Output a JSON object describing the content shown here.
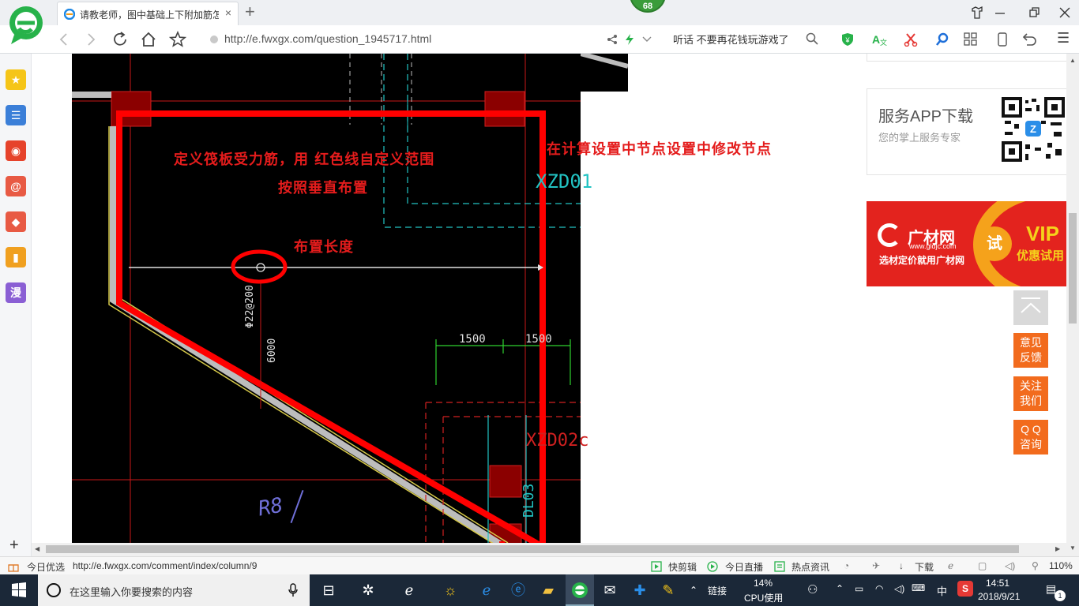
{
  "browser": {
    "tab_title": "请教老师，图中基础上下附加筋怎",
    "tab_close": "×",
    "new_tab": "+",
    "badge": "68",
    "url": "http://e.fwxgx.com/question_1945717.html",
    "hot_search": "听话 不要再花钱玩游戏了",
    "menu_glyph": "☰"
  },
  "sidebar": {
    "items": [
      {
        "name": "favorites",
        "glyph": "★",
        "color": "#f5c518"
      },
      {
        "name": "news",
        "glyph": "☰",
        "color": "#3b7fd8"
      },
      {
        "name": "weibo",
        "glyph": "◉",
        "color": "#e6432b"
      },
      {
        "name": "mail",
        "glyph": "@",
        "color": "#e85a44"
      },
      {
        "name": "game",
        "glyph": "◆",
        "color": "#e85a44"
      },
      {
        "name": "reader",
        "glyph": "▮",
        "color": "#f0a020"
      },
      {
        "name": "comic",
        "glyph": "漫",
        "color": "#8a5fd4"
      }
    ],
    "add": "+"
  },
  "cad": {
    "annotation1": "定义筏板受力筋，用 红色线自定义范围",
    "annotation2": "按照垂直布置",
    "annotation3": "布置长度",
    "annotation4": "在计算设置中节点设置中修改节点",
    "label_xzd01": "XZD01",
    "label_xzd02": "XZD02c",
    "label_dl03": "DL03",
    "label_r8": "R8",
    "rebar": "Φ22@200",
    "length": "6000",
    "dim1": "1500",
    "dim2": "1500"
  },
  "right": {
    "app_title": "服务APP下载",
    "app_sub": "您的掌上服务专家",
    "ad_brand": "广材网",
    "ad_domain": "www.gldjc.com",
    "ad_slogan": "选材定价就用广材网",
    "ad_try": "试",
    "ad_vip": "VIP",
    "ad_vip2": "优惠试用",
    "btn_feedback": [
      "意见",
      "反馈"
    ],
    "btn_follow": [
      "关注",
      "我们"
    ],
    "btn_qq": [
      "Q Q",
      "咨询"
    ]
  },
  "status": {
    "left": "今日优选",
    "link": "http://e.fwxgx.com/comment/index/column/9",
    "kuaijianji": "快剪辑",
    "live": "今日直播",
    "news": "热点资讯",
    "download": "下载",
    "zoom": "110%"
  },
  "taskbar": {
    "search": "在这里输入你要搜索的内容",
    "link": "链接",
    "cpu": "14%",
    "cpu_label": "CPU使用",
    "ime": "中",
    "time": "14:51",
    "date": "2018/9/21",
    "notif": "1"
  }
}
